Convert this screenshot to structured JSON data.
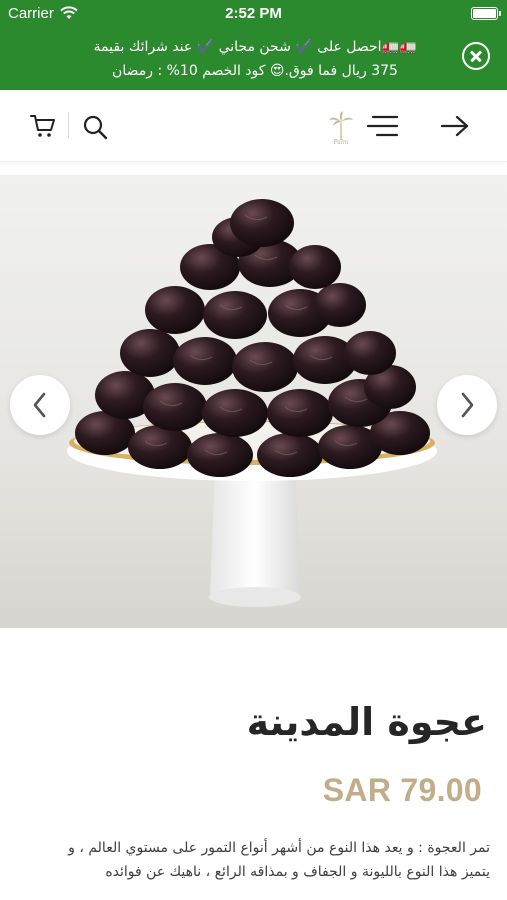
{
  "status_bar": {
    "carrier": "Carrier",
    "time": "2:52 PM"
  },
  "promo_banner": {
    "line1": "🚛🚛احصل على ✔️ شحن مجاني ✔️ عند شرائك بقيمة",
    "line2": "375 ريال فما فوق.😍 كود الخصم 10%  : رمضان",
    "background_color": "#2c8a2e",
    "close_icon": "close-circle-icon"
  },
  "header": {
    "logo_text": "Palm",
    "icons": [
      "cart-icon",
      "search-icon",
      "logo-icon",
      "menu-icon",
      "back-arrow-icon"
    ]
  },
  "carousel": {
    "image": "dates-on-cake-stand",
    "prev_icon": "chevron-left-icon",
    "next_icon": "chevron-right-icon"
  },
  "product": {
    "title": "عجوة المدينة",
    "price": "SAR 79.00",
    "price_color": "#c2ad89",
    "description_line1": "تمر العجوة : و يعد هذا النوع من أشهر أنواع التمور على مستوي العالم ، و",
    "description_line2": "يتميز هذا النوع بالليونة و الجفاف و بمذاقه الرائع ، ناهيك عن فوائده"
  }
}
